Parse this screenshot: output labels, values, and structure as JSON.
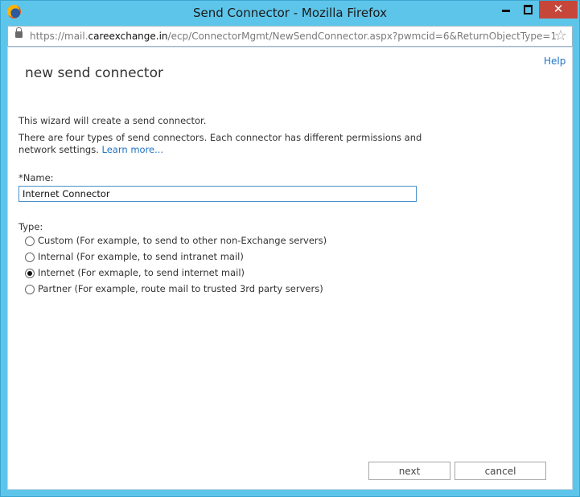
{
  "window": {
    "title": "Send Connector - Mozilla Firefox",
    "url_prefix": "https://mail.",
    "url_domain": "careexchange.in",
    "url_path": "/ecp/ConnectorMgmt/NewSendConnector.aspx?pwmcid=6&ReturnObjectType=1"
  },
  "page": {
    "help": "Help",
    "title": "new send connector",
    "intro": "This wizard will create a send connector.",
    "desc_line1": "There are four types of send connectors. Each connector has different permissions and",
    "desc_line2": "network settings.",
    "learn_more": "Learn more...",
    "name_label": "*Name:",
    "name_value": "Internet Connector",
    "type_label": "Type:"
  },
  "types": [
    {
      "label": "Custom (For example, to send to other non-Exchange servers)",
      "checked": false
    },
    {
      "label": "Internal (For example, to send intranet mail)",
      "checked": false
    },
    {
      "label": "Internet (For exmaple, to send internet mail)",
      "checked": true
    },
    {
      "label": "Partner (For example, route mail to trusted 3rd party servers)",
      "checked": false
    }
  ],
  "buttons": {
    "next": "next",
    "cancel": "cancel"
  }
}
